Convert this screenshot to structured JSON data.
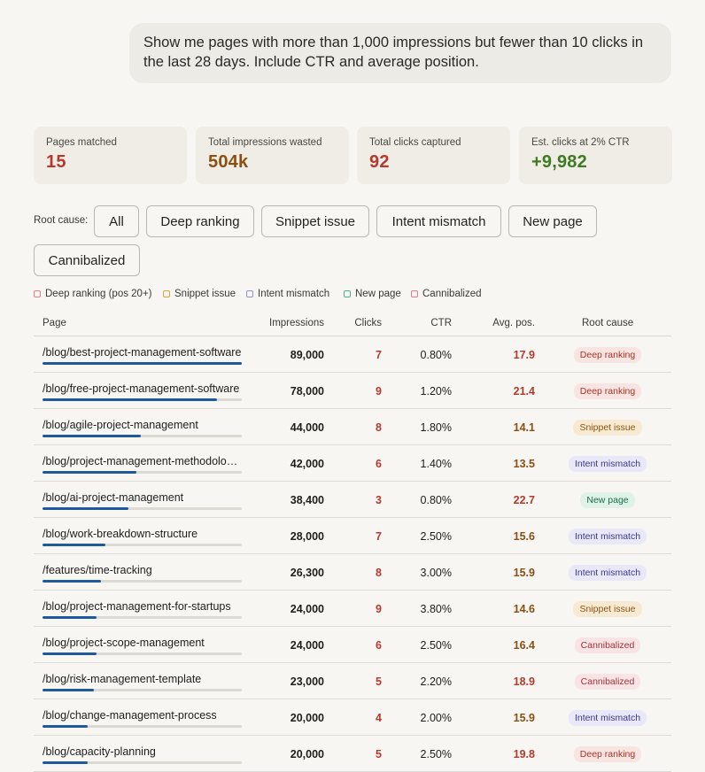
{
  "prompt": {
    "line1": "Show me pages with more than 1,000 impressions but fewer than 10 clicks in",
    "line2": "the last 28 days. Include CTR and average position."
  },
  "stats": [
    {
      "label": "Pages matched",
      "value": "15",
      "color": "#b33a2c"
    },
    {
      "label": "Total impressions wasted",
      "value": "504k",
      "color": "#8a4f12"
    },
    {
      "label": "Total clicks captured",
      "value": "92",
      "color": "#b33a2c"
    },
    {
      "label": "Est. clicks at 2% CTR",
      "value": "+9,982",
      "color": "#3e7a22"
    }
  ],
  "filters": {
    "label": "Root cause:",
    "chips": [
      "All",
      "Deep ranking",
      "Snippet issue",
      "Intent mismatch",
      "New page",
      "Cannibalized"
    ]
  },
  "legend": [
    {
      "label": "Deep ranking (pos 20+)",
      "color": "#e08080"
    },
    {
      "label": "Snippet issue",
      "color": "#e0a040"
    },
    {
      "label": "Intent mismatch",
      "color": "#9090d8"
    },
    {
      "label": "New page",
      "color": "#50b090"
    },
    {
      "label": "Cannibalized",
      "color": "#e07a90"
    }
  ],
  "table": {
    "headers": {
      "page": "Page",
      "impressions": "Impressions",
      "clicks": "Clicks",
      "ctr": "CTR",
      "pos": "Avg. pos.",
      "cause": "Root cause"
    },
    "max_impressions": 89000,
    "rows": [
      {
        "page": "/blog/best-project-management-software",
        "impressions": "89,000",
        "imp_value": 89000,
        "clicks": "7",
        "ctr": "0.80%",
        "pos": "17.9",
        "cause": "Deep ranking"
      },
      {
        "page": "/blog/free-project-management-software",
        "impressions": "78,000",
        "imp_value": 78000,
        "clicks": "9",
        "ctr": "1.20%",
        "pos": "21.4",
        "cause": "Deep ranking"
      },
      {
        "page": "/blog/agile-project-management",
        "impressions": "44,000",
        "imp_value": 44000,
        "clicks": "8",
        "ctr": "1.80%",
        "pos": "14.1",
        "cause": "Snippet issue"
      },
      {
        "page": "/blog/project-management-methodologies",
        "impressions": "42,000",
        "imp_value": 42000,
        "clicks": "6",
        "ctr": "1.40%",
        "pos": "13.5",
        "cause": "Intent mismatch"
      },
      {
        "page": "/blog/ai-project-management",
        "impressions": "38,400",
        "imp_value": 38400,
        "clicks": "3",
        "ctr": "0.80%",
        "pos": "22.7",
        "cause": "New page"
      },
      {
        "page": "/blog/work-breakdown-structure",
        "impressions": "28,000",
        "imp_value": 28000,
        "clicks": "7",
        "ctr": "2.50%",
        "pos": "15.6",
        "cause": "Intent mismatch"
      },
      {
        "page": "/features/time-tracking",
        "impressions": "26,300",
        "imp_value": 26300,
        "clicks": "8",
        "ctr": "3.00%",
        "pos": "15.9",
        "cause": "Intent mismatch"
      },
      {
        "page": "/blog/project-management-for-startups",
        "impressions": "24,000",
        "imp_value": 24000,
        "clicks": "9",
        "ctr": "3.80%",
        "pos": "14.6",
        "cause": "Snippet issue"
      },
      {
        "page": "/blog/project-scope-management",
        "impressions": "24,000",
        "imp_value": 24000,
        "clicks": "6",
        "ctr": "2.50%",
        "pos": "16.4",
        "cause": "Cannibalized"
      },
      {
        "page": "/blog/risk-management-template",
        "impressions": "23,000",
        "imp_value": 23000,
        "clicks": "5",
        "ctr": "2.20%",
        "pos": "18.9",
        "cause": "Cannibalized"
      },
      {
        "page": "/blog/change-management-process",
        "impressions": "20,000",
        "imp_value": 20000,
        "clicks": "4",
        "ctr": "2.00%",
        "pos": "15.9",
        "cause": "Intent mismatch"
      },
      {
        "page": "/blog/capacity-planning",
        "impressions": "20,000",
        "imp_value": 20000,
        "clicks": "5",
        "ctr": "2.50%",
        "pos": "19.8",
        "cause": "Deep ranking"
      }
    ]
  },
  "cause_styles": {
    "Deep ranking": {
      "bg": "#f8e4e1",
      "fg": "#a93226"
    },
    "Snippet issue": {
      "bg": "#f8ead2",
      "fg": "#8a5412"
    },
    "Intent mismatch": {
      "bg": "#e8e8f8",
      "fg": "#3b3a8c"
    },
    "New page": {
      "bg": "#dff2e8",
      "fg": "#1e6b44"
    },
    "Cannibalized": {
      "bg": "#f8e4e4",
      "fg": "#a1323a"
    }
  },
  "pos_colors": {
    "high": "#b33a2c",
    "mid": "#8a4f12"
  }
}
